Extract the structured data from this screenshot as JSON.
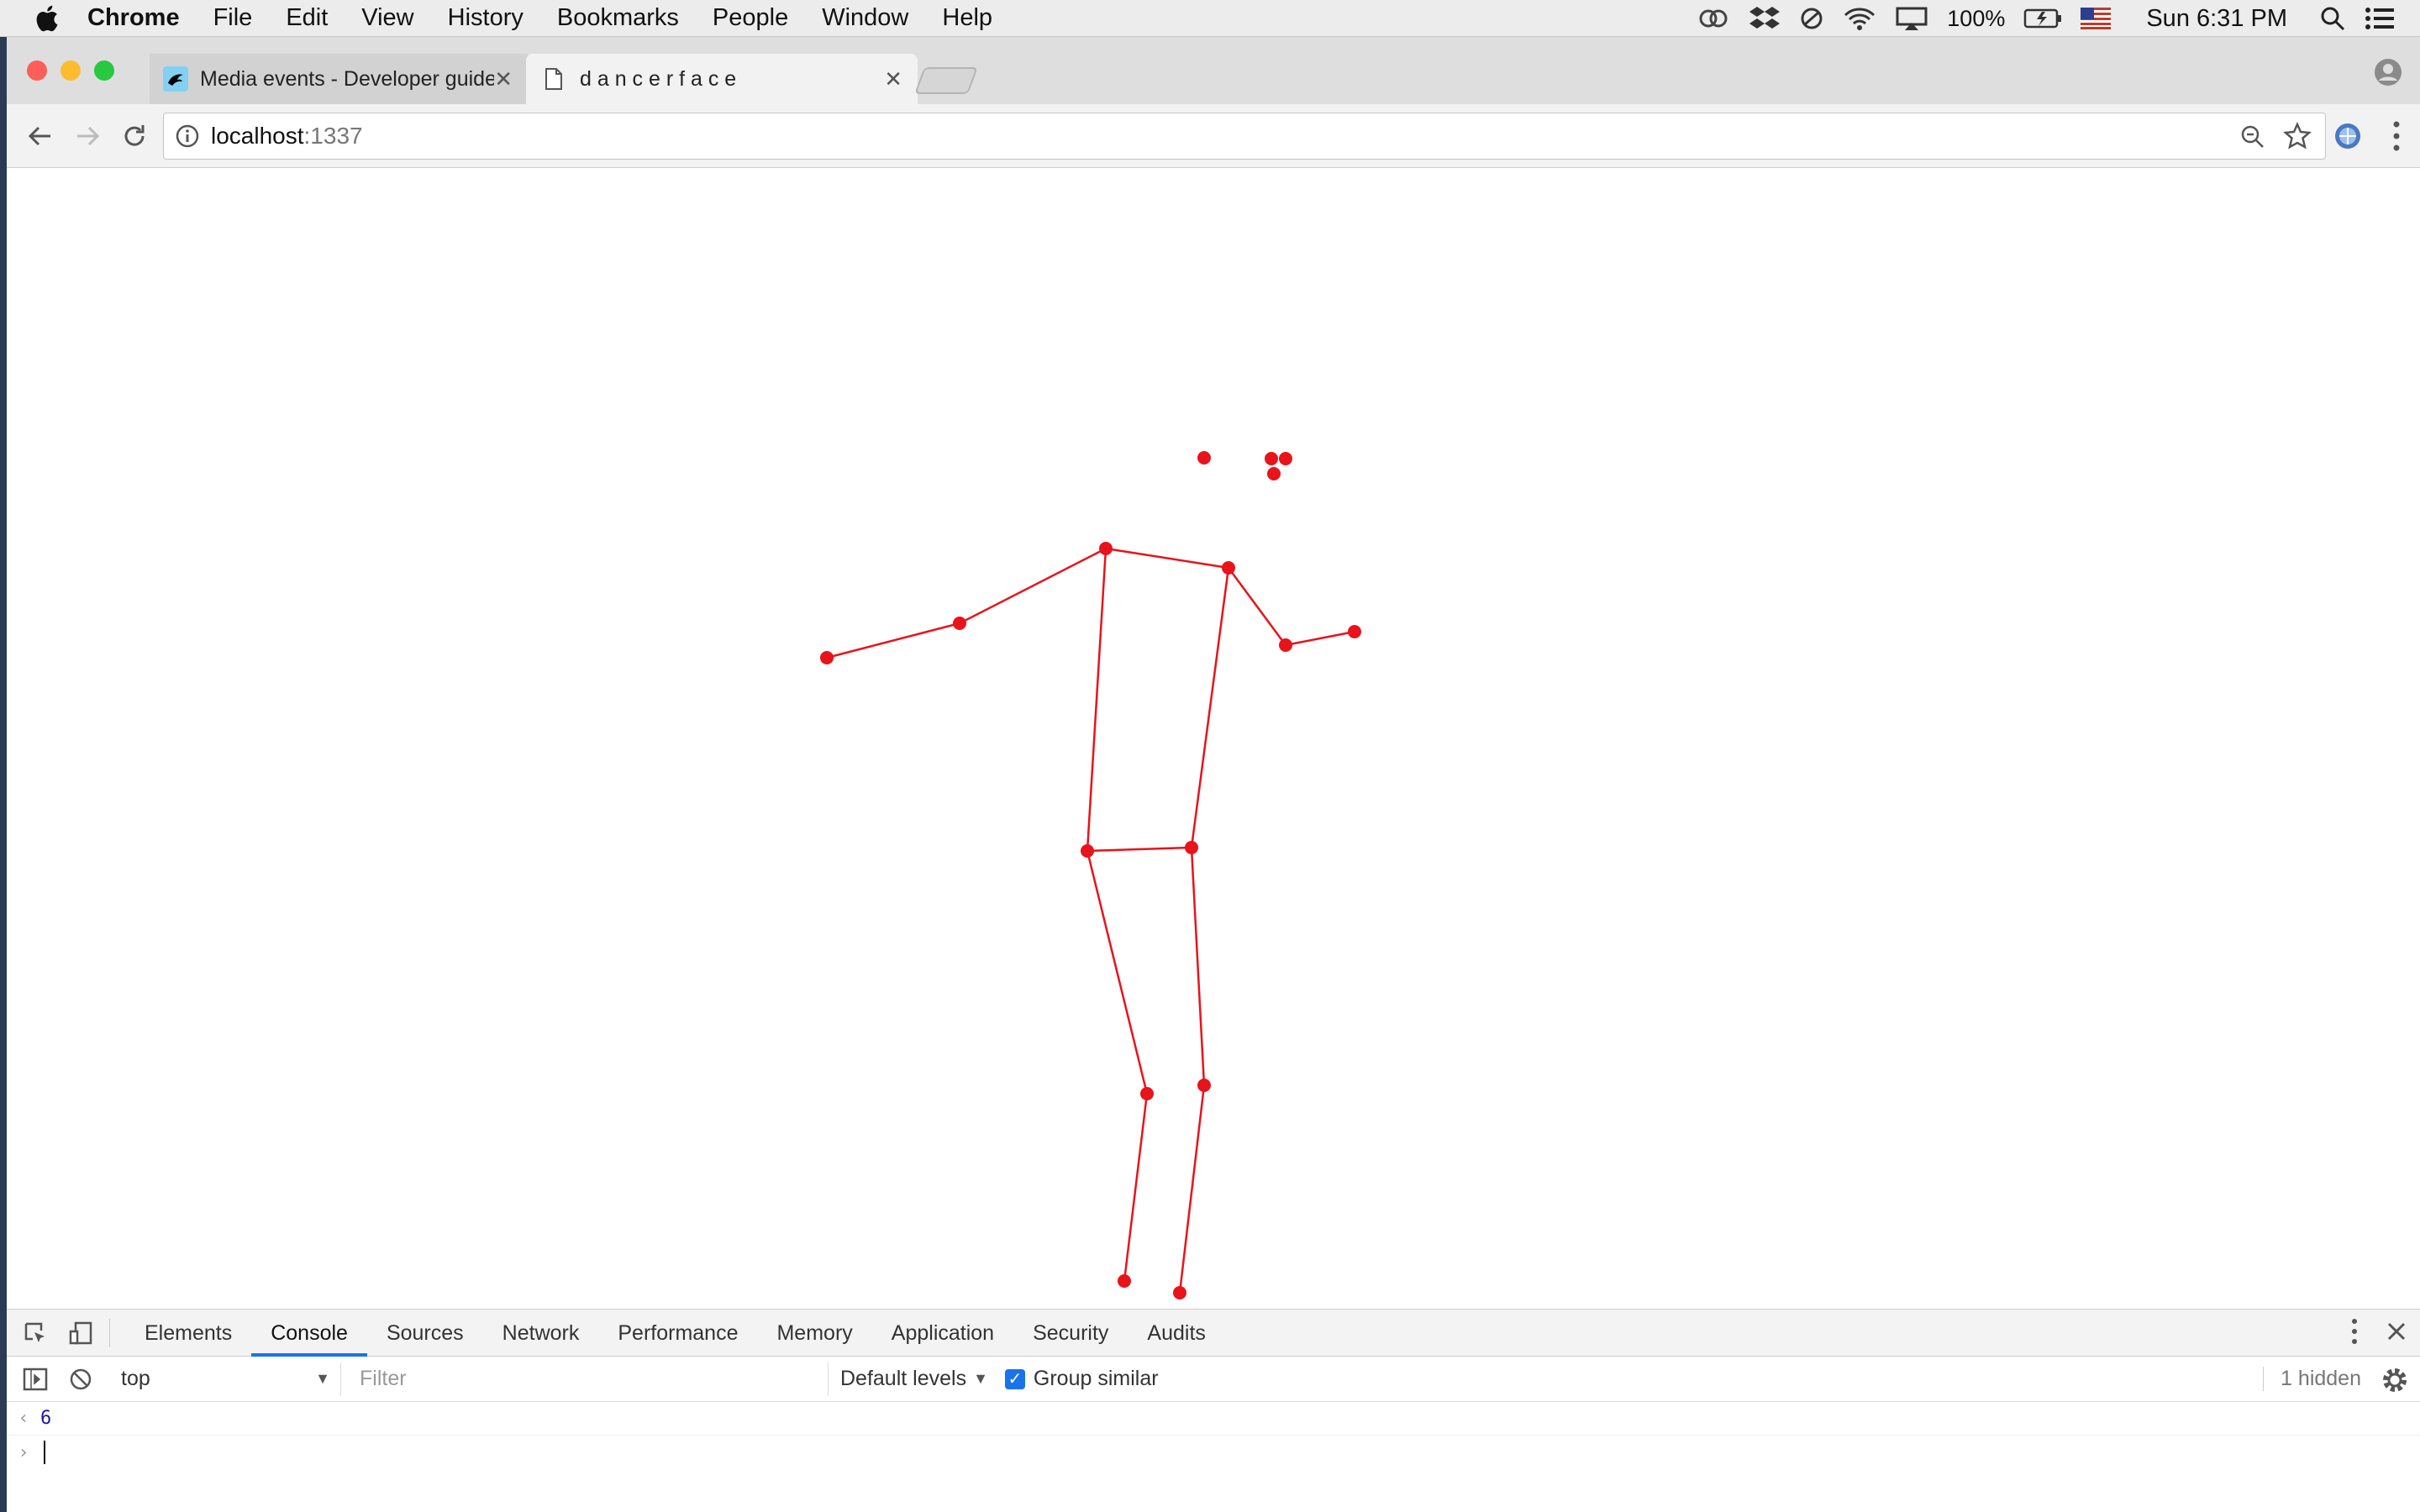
{
  "menubar": {
    "app_name": "Chrome",
    "items": [
      "File",
      "Edit",
      "View",
      "History",
      "Bookmarks",
      "People",
      "Window",
      "Help"
    ],
    "battery": "100%",
    "clock": "Sun 6:31 PM"
  },
  "browser": {
    "tabs": [
      {
        "title": "Media events - Developer guide",
        "active": false
      },
      {
        "title": "d a n c e r f a c e",
        "active": true
      }
    ],
    "url_host": "localhost",
    "url_port": ":1337"
  },
  "devtools": {
    "tabs": [
      "Elements",
      "Console",
      "Sources",
      "Network",
      "Performance",
      "Memory",
      "Application",
      "Security",
      "Audits"
    ],
    "active_tab": "Console",
    "context": "top",
    "filter_placeholder": "Filter",
    "levels": "Default levels",
    "group_similar": "Group similar",
    "hidden_count": "1 hidden",
    "console_output": "6"
  },
  "colors": {
    "skeleton": "#e8131b",
    "accent": "#1a73e8"
  }
}
